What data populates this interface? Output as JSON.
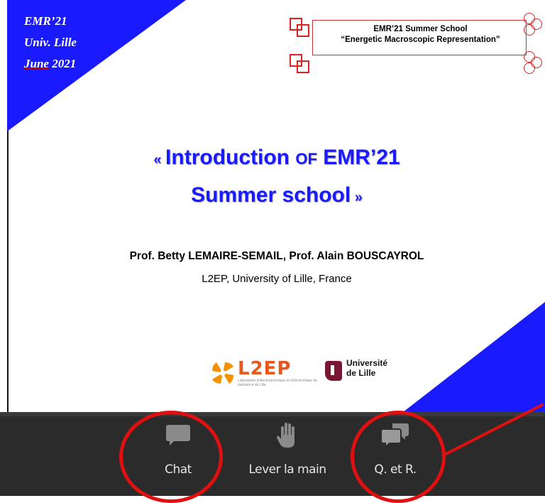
{
  "slide": {
    "corner": {
      "line1": "EMR’21",
      "line2": "Univ. Lille",
      "line3_month": "June",
      "line3_year": " 2021"
    },
    "logo": {
      "line1": "EMR’21 Summer School",
      "line2": "“Energetic Macroscopic Representation”"
    },
    "title": {
      "open": "« ",
      "part1": "Introduction ",
      "of": "OF",
      "part2": " EMR’21",
      "line2": "Summer school",
      "close": " »"
    },
    "authors": "Prof. Betty LEMAIRE-SEMAIL, Prof. Alain BOUSCAYROL",
    "affiliation": "L2EP, University of Lille, France",
    "l2ep_logo": {
      "name": "L2EP",
      "subtitle": "Laboratoire d'électrotechnique et d'électronique de puissance de Lille"
    },
    "univ_logo": {
      "line1": "Université",
      "line2": "de Lille"
    },
    "colors": {
      "accent_blue": "#1a1aff",
      "annotation_red": "#e01010",
      "toolbar_bg": "#2b2b2b"
    }
  },
  "toolbar": {
    "chat_label": "Chat",
    "chat_icon": "speech-bubble-icon",
    "hand_label": "Lever la main",
    "hand_icon": "raised-hand-icon",
    "qa_label": "Q. et R.",
    "qa_icon": "two-speech-bubbles-icon"
  }
}
